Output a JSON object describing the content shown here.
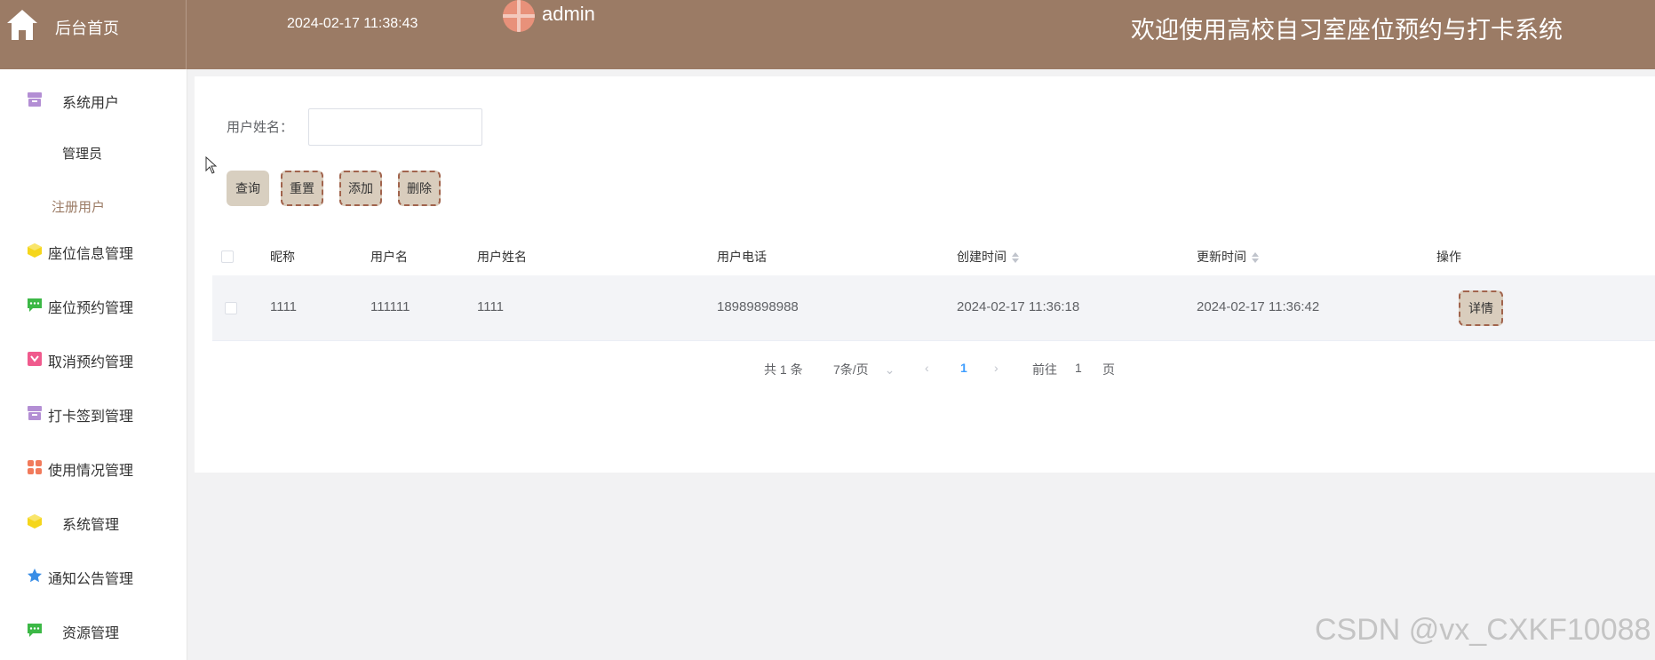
{
  "header": {
    "home_label": "后台首页",
    "datetime": "2024-02-17 11:38:43",
    "username": "admin",
    "system_title": "欢迎使用高校自习室座位预约与打卡系统"
  },
  "sidebar": {
    "items": [
      {
        "label": "系统用户",
        "icon": "archive-icon",
        "color": "#b38ed4"
      },
      {
        "label": "座位信息管理",
        "icon": "cube-icon",
        "color": "#f5d61c"
      },
      {
        "label": "座位预约管理",
        "icon": "chat-icon",
        "color": "#3cb846"
      },
      {
        "label": "取消预约管理",
        "icon": "gift-icon",
        "color": "#f05a8d"
      },
      {
        "label": "打卡签到管理",
        "icon": "archive-icon",
        "color": "#b38ed4"
      },
      {
        "label": "使用情况管理",
        "icon": "grid-icon",
        "color": "#f17a5b"
      },
      {
        "label": "系统管理",
        "icon": "cube-icon",
        "color": "#f5d61c"
      },
      {
        "label": "通知公告管理",
        "icon": "star-icon",
        "color": "#3a8ee6"
      },
      {
        "label": "资源管理",
        "icon": "chat-icon",
        "color": "#3cb846"
      }
    ],
    "sub_items": [
      {
        "label": "管理员"
      },
      {
        "label": "注册用户"
      }
    ]
  },
  "search": {
    "label": "用户姓名：",
    "value": "",
    "placeholder": ""
  },
  "buttons": {
    "query": "查询",
    "reset": "重置",
    "add": "添加",
    "delete": "删除"
  },
  "table": {
    "columns": [
      "昵称",
      "用户名",
      "用户姓名",
      "用户电话",
      "创建时间",
      "更新时间",
      "操作"
    ],
    "rows": [
      {
        "nickname": "1111",
        "username": "111111",
        "realname": "1111",
        "phone": "18989898988",
        "created": "2024-02-17 11:36:18",
        "updated": "2024-02-17 11:36:42",
        "action": "详情"
      }
    ]
  },
  "pagination": {
    "total": "共 1 条",
    "page_size": "7条/页",
    "current_page": "1",
    "goto_label": "前往",
    "goto_value": "1",
    "page_suffix": "页"
  },
  "watermark": "CSDN @vx_CXKF10088",
  "colors": {
    "header_bg": "#9b7b65",
    "button_bg": "#d9cdbd",
    "accent_blue": "#409eff"
  }
}
